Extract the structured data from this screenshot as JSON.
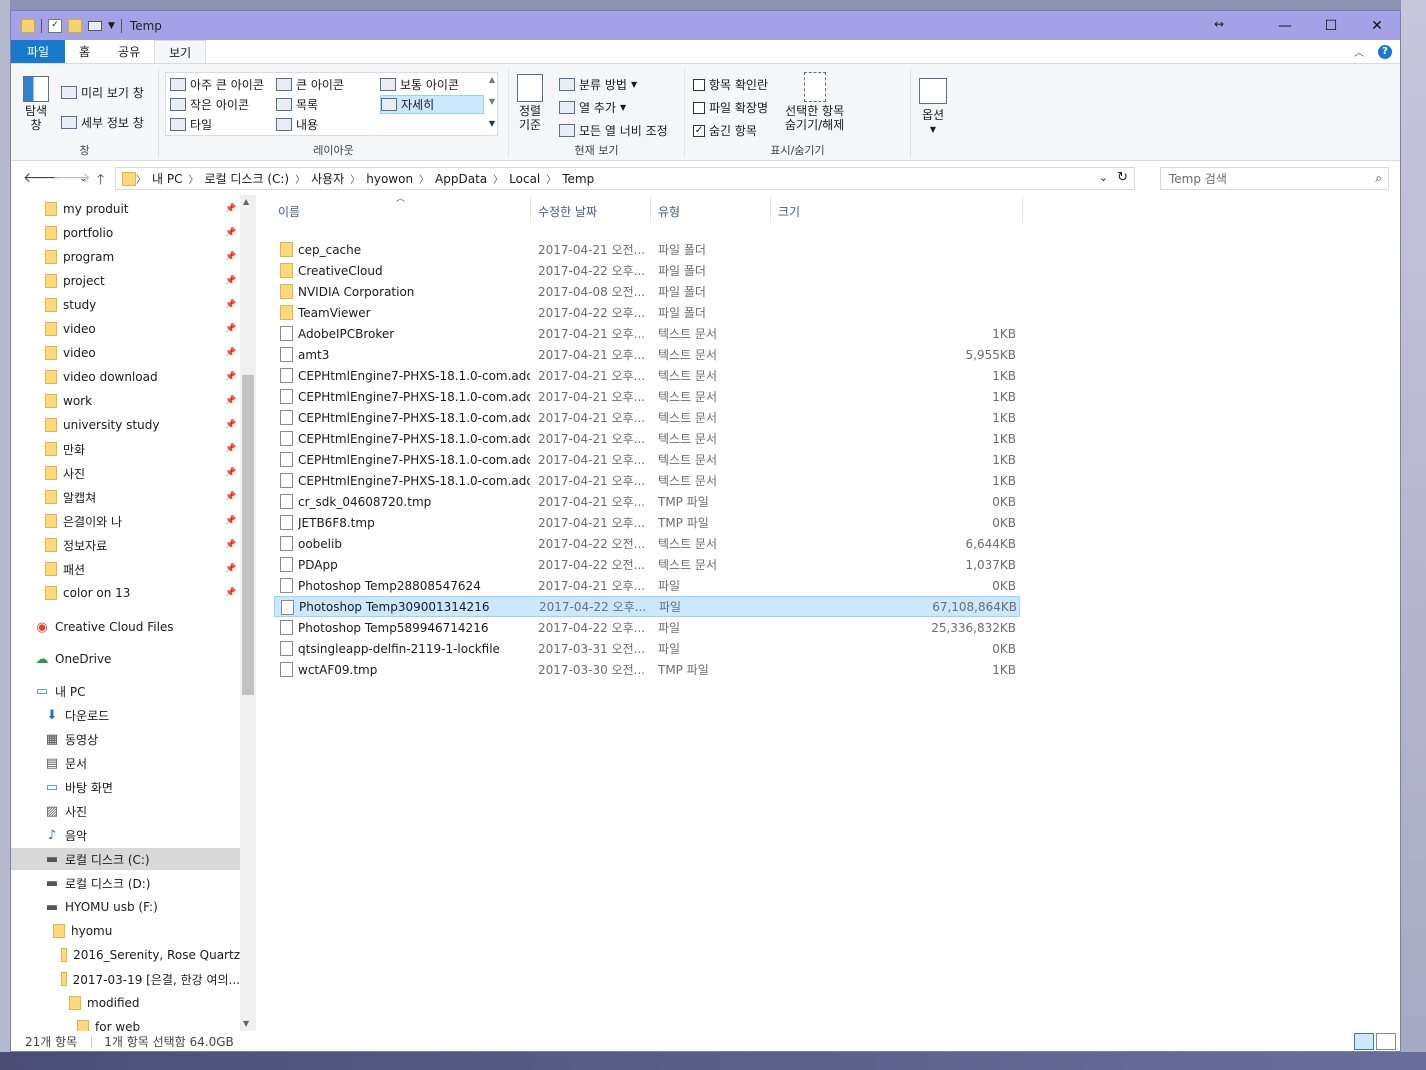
{
  "window": {
    "title": "Temp"
  },
  "tabs": [
    {
      "label": "파일"
    },
    {
      "label": "홈"
    },
    {
      "label": "공유"
    },
    {
      "label": "보기"
    }
  ],
  "ribbon": {
    "pane": {
      "nav_pane": "탐색\n창",
      "preview": "미리 보기 창",
      "details": "세부 정보 창",
      "group_label": "창"
    },
    "layout": {
      "items": [
        "아주 큰 아이콘",
        "큰 아이콘",
        "보통 아이콘",
        "작은 아이콘",
        "목록",
        "자세히",
        "타일",
        "내용"
      ],
      "group_label": "레이아웃"
    },
    "current_view": {
      "sort": "정렬\n기준",
      "group_by": "분류 방법",
      "add_column": "열 추가",
      "fit_columns": "모든 열 너비 조정",
      "group_label": "현재 보기"
    },
    "show_hide": {
      "item_checkboxes": "항목 확인란",
      "file_ext": "파일 확장명",
      "hidden_items": "숨긴 항목",
      "hide_selected": "선택한 항목\n숨기기/해제",
      "group_label": "표시/숨기기"
    },
    "options": "옵션"
  },
  "address": {
    "crumbs": [
      "내 PC",
      "로컬 디스크 (C:)",
      "사용자",
      "hyowon",
      "AppData",
      "Local",
      "Temp"
    ],
    "search_placeholder": "Temp 검색"
  },
  "nav": {
    "quick_access": [
      "my produit",
      "portfolio",
      "program",
      "project",
      "study",
      "video",
      "video",
      "video download",
      "work",
      "university study",
      "만화",
      "사진",
      "알캡쳐",
      "은결이와 나",
      "정보자료",
      "패션",
      "color on 13"
    ],
    "creative_cloud": "Creative Cloud Files",
    "onedrive": "OneDrive",
    "this_pc": "내 PC",
    "pc_items": [
      "다운로드",
      "동영상",
      "문서",
      "바탕 화면",
      "사진",
      "음악",
      "로컬 디스크 (C:)",
      "로컬 디스크 (D:)",
      "HYOMU usb (F:)"
    ],
    "usb_tree": [
      "hyomu",
      "2016_Serenity, Rose Quartz",
      "2017-03-19 [은결, 한강 여의...",
      "modified",
      "for web"
    ]
  },
  "columns": {
    "name": "이름",
    "date": "수정한 날짜",
    "type": "유형",
    "size": "크기"
  },
  "files": [
    {
      "name": "cep_cache",
      "date": "2017-04-21 오전...",
      "type": "파일 폴더",
      "size": "",
      "folder": true
    },
    {
      "name": "CreativeCloud",
      "date": "2017-04-22 오후...",
      "type": "파일 폴더",
      "size": "",
      "folder": true
    },
    {
      "name": "NVIDIA Corporation",
      "date": "2017-04-08 오전...",
      "type": "파일 폴더",
      "size": "",
      "folder": true
    },
    {
      "name": "TeamViewer",
      "date": "2017-04-22 오후...",
      "type": "파일 폴더",
      "size": "",
      "folder": true
    },
    {
      "name": "AdobeIPCBroker",
      "date": "2017-04-21 오후...",
      "type": "텍스트 문서",
      "size": "1KB"
    },
    {
      "name": "amt3",
      "date": "2017-04-21 오후...",
      "type": "텍스트 문서",
      "size": "5,955KB"
    },
    {
      "name": "CEPHtmlEngine7-PHXS-18.1.0-com.ado...",
      "date": "2017-04-21 오후...",
      "type": "텍스트 문서",
      "size": "1KB"
    },
    {
      "name": "CEPHtmlEngine7-PHXS-18.1.0-com.ado...",
      "date": "2017-04-21 오후...",
      "type": "텍스트 문서",
      "size": "1KB"
    },
    {
      "name": "CEPHtmlEngine7-PHXS-18.1.0-com.ado...",
      "date": "2017-04-21 오후...",
      "type": "텍스트 문서",
      "size": "1KB"
    },
    {
      "name": "CEPHtmlEngine7-PHXS-18.1.0-com.ado...",
      "date": "2017-04-21 오후...",
      "type": "텍스트 문서",
      "size": "1KB"
    },
    {
      "name": "CEPHtmlEngine7-PHXS-18.1.0-com.ado...",
      "date": "2017-04-21 오후...",
      "type": "텍스트 문서",
      "size": "1KB"
    },
    {
      "name": "CEPHtmlEngine7-PHXS-18.1.0-com.ado...",
      "date": "2017-04-21 오후...",
      "type": "텍스트 문서",
      "size": "1KB"
    },
    {
      "name": "cr_sdk_04608720.tmp",
      "date": "2017-04-21 오후...",
      "type": "TMP 파일",
      "size": "0KB"
    },
    {
      "name": "JETB6F8.tmp",
      "date": "2017-04-21 오후...",
      "type": "TMP 파일",
      "size": "0KB"
    },
    {
      "name": "oobelib",
      "date": "2017-04-22 오전...",
      "type": "텍스트 문서",
      "size": "6,644KB"
    },
    {
      "name": "PDApp",
      "date": "2017-04-22 오전...",
      "type": "텍스트 문서",
      "size": "1,037KB"
    },
    {
      "name": "Photoshop Temp28808547624",
      "date": "2017-04-21 오후...",
      "type": "파일",
      "size": "0KB"
    },
    {
      "name": "Photoshop Temp309001314216",
      "date": "2017-04-22 오후...",
      "type": "파일",
      "size": "67,108,864KB",
      "selected": true
    },
    {
      "name": "Photoshop Temp589946714216",
      "date": "2017-04-22 오후...",
      "type": "파일",
      "size": "25,336,832KB"
    },
    {
      "name": "qtsingleapp-delfin-2119-1-lockfile",
      "date": "2017-03-31 오전...",
      "type": "파일",
      "size": "0KB"
    },
    {
      "name": "wctAF09.tmp",
      "date": "2017-03-30 오전...",
      "type": "TMP 파일",
      "size": "1KB"
    }
  ],
  "status": {
    "count": "21개 항목",
    "selection": "1개 항목 선택함 64.0GB"
  },
  "colors": {
    "title_bar": "#a6a2e8",
    "file_tab": "#1979ca",
    "selection": "#cce8ff"
  }
}
